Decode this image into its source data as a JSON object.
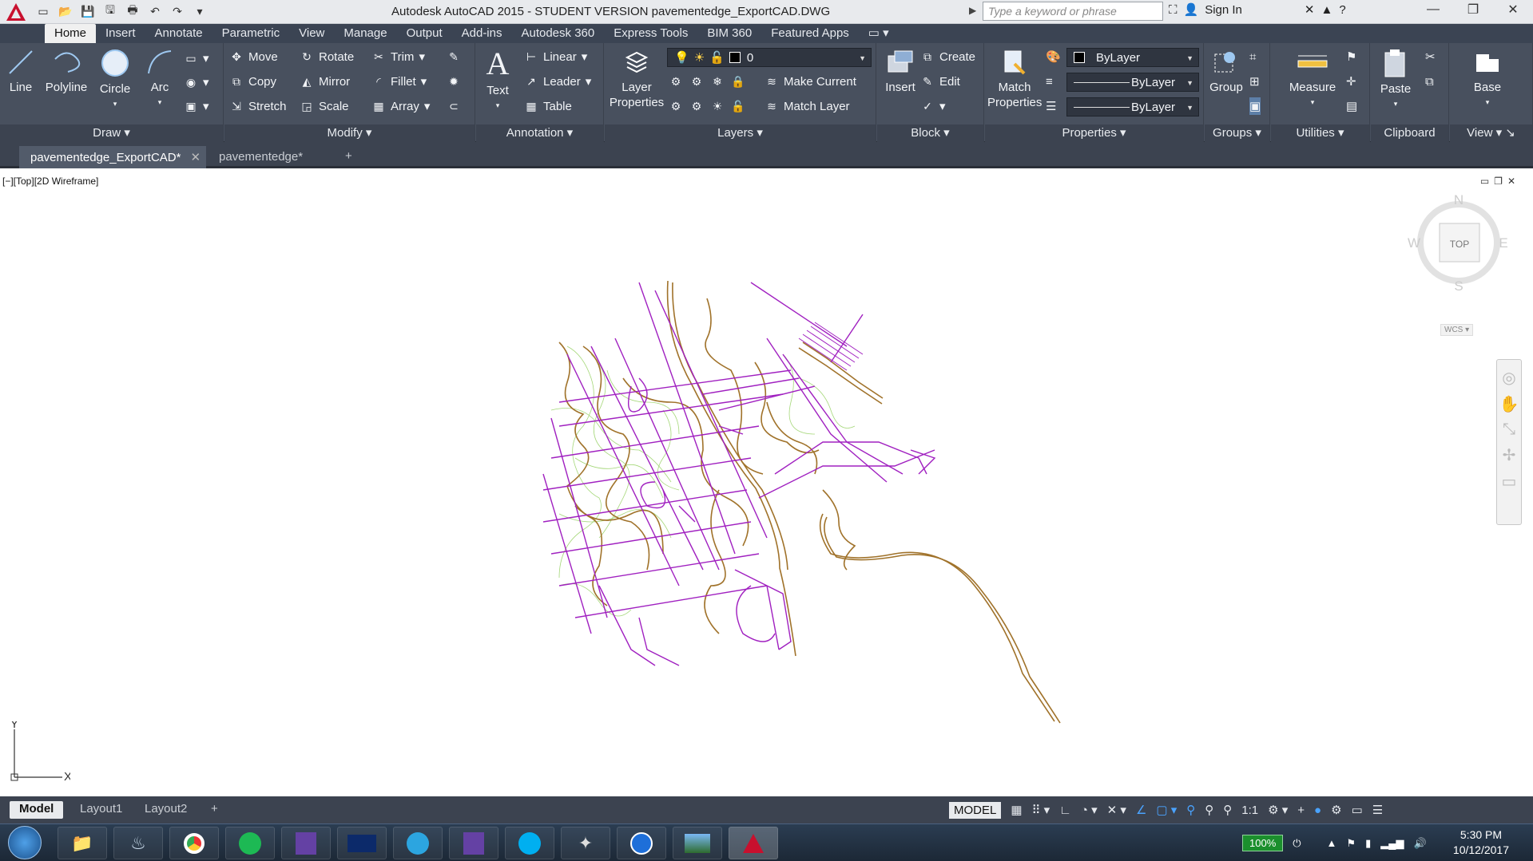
{
  "app": {
    "title": "Autodesk AutoCAD 2015 - STUDENT VERSION    pavementedge_ExportCAD.DWG",
    "search_placeholder": "Type a keyword or phrase",
    "sign_in": "Sign In"
  },
  "ribbon_tabs": [
    "Home",
    "Insert",
    "Annotate",
    "Parametric",
    "View",
    "Manage",
    "Output",
    "Add-ins",
    "Autodesk 360",
    "Express Tools",
    "BIM 360",
    "Featured Apps"
  ],
  "panels": {
    "draw": {
      "title": "Draw",
      "line": "Line",
      "polyline": "Polyline",
      "circle": "Circle",
      "arc": "Arc"
    },
    "modify": {
      "title": "Modify",
      "move": "Move",
      "rotate": "Rotate",
      "trim": "Trim",
      "copy": "Copy",
      "mirror": "Mirror",
      "fillet": "Fillet",
      "stretch": "Stretch",
      "scale": "Scale",
      "array": "Array"
    },
    "annotation": {
      "title": "Annotation",
      "text": "Text",
      "linear": "Linear",
      "leader": "Leader",
      "table": "Table"
    },
    "layers": {
      "title": "Layers",
      "layer_properties": "Layer Properties",
      "current_layer": "0",
      "make_current": "Make Current",
      "match_layer": "Match Layer"
    },
    "block": {
      "title": "Block",
      "insert": "Insert",
      "create": "Create",
      "edit": "Edit"
    },
    "properties": {
      "title": "Properties",
      "match_properties": "Match Properties",
      "color": "ByLayer",
      "linetype": "ByLayer",
      "lineweight": "ByLayer"
    },
    "groups": {
      "title": "Groups",
      "group": "Group"
    },
    "utilities": {
      "title": "Utilities",
      "measure": "Measure"
    },
    "clipboard": {
      "title": "Clipboard",
      "paste": "Paste"
    },
    "view": {
      "title": "View",
      "base": "Base"
    }
  },
  "doc_tabs": [
    "pavementedge_ExportCAD*",
    "pavementedge*"
  ],
  "viewport": {
    "label": "[−][Top][2D Wireframe]",
    "viewcube": {
      "top": "TOP",
      "n": "N",
      "s": "S",
      "e": "E",
      "w": "W",
      "wcs": "WCS"
    },
    "ucs_x": "X",
    "ucs_y": "Y"
  },
  "layout_tabs": [
    "Model",
    "Layout1",
    "Layout2"
  ],
  "status": {
    "model": "MODEL",
    "scale": "1:1"
  },
  "taskbar": {
    "battery": "100%",
    "time": "5:30 PM",
    "date": "10/12/2017"
  },
  "colors": {
    "road_magenta": "#a020c0",
    "edge_brown": "#a0722a",
    "contour_green": "#9bd36a",
    "ribbon_bg": "#48505e"
  }
}
